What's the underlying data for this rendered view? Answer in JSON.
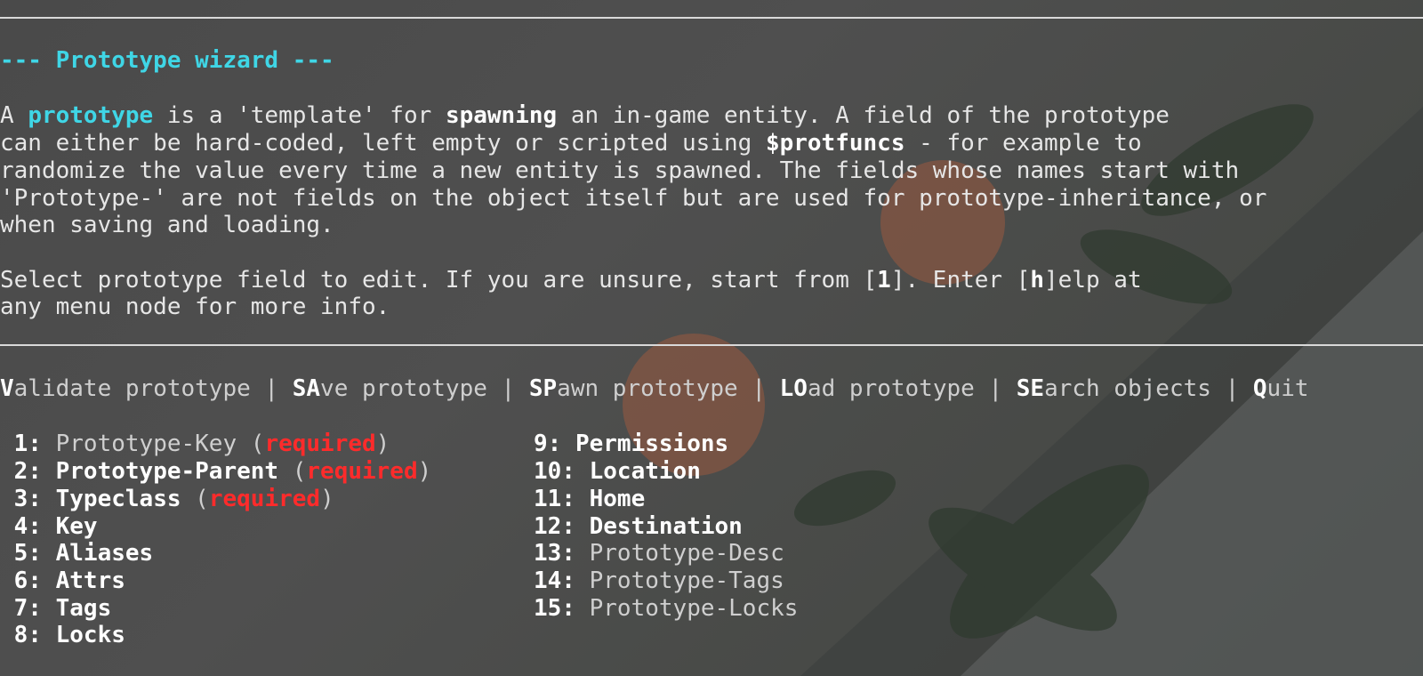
{
  "title": "--- Prototype wizard ---",
  "intro": {
    "l1": [
      "A ",
      "prototype",
      " is a 'template' for ",
      "spawning",
      " an in-game entity. A field of the prototype"
    ],
    "l2": [
      "can either be hard-coded, left empty or scripted using ",
      "$protfuncs",
      " - for example to"
    ],
    "l3": "randomize the value every time a new entity is spawned. The fields whose names start with",
    "l4": "'Prototype-' are not fields on the object itself but are used for prototype-inheritance, or",
    "l5": "when saving and loading."
  },
  "select": {
    "l1": [
      "Select prototype field to edit. If you are unsure, start from [",
      "1",
      "]. Enter [",
      "h",
      "]elp at"
    ],
    "l2": "any menu node for more info."
  },
  "actions": [
    {
      "key": "V",
      "rest": "alidate prototype"
    },
    {
      "key": "SA",
      "rest": "ve prototype"
    },
    {
      "key": "SP",
      "rest": "awn prototype"
    },
    {
      "key": "LO",
      "rest": "ad prototype"
    },
    {
      "key": "SE",
      "rest": "arch objects"
    },
    {
      "key": "Q",
      "rest": "uit"
    }
  ],
  "action_sep": " | ",
  "required_label": "required",
  "fields_left": [
    {
      "num": " 1:",
      "name": "Prototype-Key",
      "required": true,
      "dim": true
    },
    {
      "num": " 2:",
      "name": "Prototype-Parent",
      "required": true,
      "dim": false
    },
    {
      "num": " 3:",
      "name": "Typeclass",
      "required": true,
      "dim": false
    },
    {
      "num": " 4:",
      "name": "Key",
      "required": false,
      "dim": false
    },
    {
      "num": " 5:",
      "name": "Aliases",
      "required": false,
      "dim": false
    },
    {
      "num": " 6:",
      "name": "Attrs",
      "required": false,
      "dim": false
    },
    {
      "num": " 7:",
      "name": "Tags",
      "required": false,
      "dim": false
    },
    {
      "num": " 8:",
      "name": "Locks",
      "required": false,
      "dim": false
    }
  ],
  "fields_right": [
    {
      "num": "9:",
      "name": "Permissions",
      "dim": false
    },
    {
      "num": "10:",
      "name": "Location",
      "dim": false
    },
    {
      "num": "11:",
      "name": "Home",
      "dim": false
    },
    {
      "num": "12:",
      "name": "Destination",
      "dim": false
    },
    {
      "num": "13:",
      "name": "Prototype-Desc",
      "dim": true
    },
    {
      "num": "14:",
      "name": "Prototype-Tags",
      "dim": true
    },
    {
      "num": "15:",
      "name": "Prototype-Locks",
      "dim": true
    }
  ]
}
